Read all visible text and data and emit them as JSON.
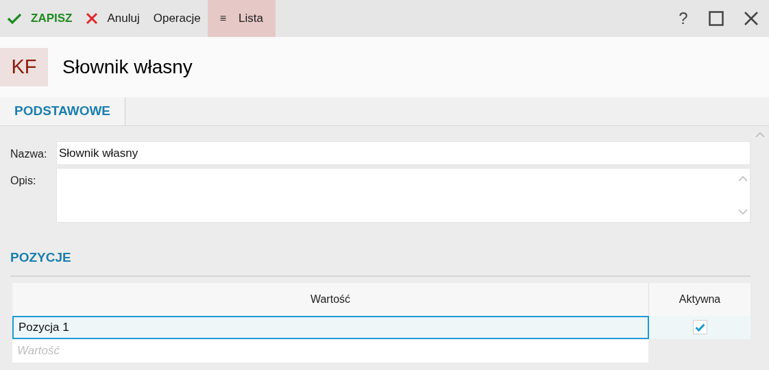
{
  "toolbar": {
    "items": [
      {
        "kind": "save",
        "label": "ZAPISZ",
        "selected": false
      },
      {
        "kind": "cancel",
        "label": "Anuluj",
        "selected": false
      },
      {
        "kind": "plain",
        "label": "Operacje",
        "selected": false
      },
      {
        "kind": "list",
        "icon": "≡",
        "label": "Lista",
        "selected": true
      }
    ],
    "help": "?"
  },
  "header": {
    "badge": "KF",
    "title": "Słownik własny"
  },
  "tabs": [
    {
      "label": "PODSTAWOWE",
      "selected": true
    }
  ],
  "form": {
    "fields": [
      {
        "label": "Nazwa:",
        "value": "Słownik własny",
        "kind": "line"
      },
      {
        "label": "Opis:",
        "kind": "area"
      }
    ]
  },
  "section": {
    "title": "POZYCJE"
  },
  "table": {
    "columns": [
      "Wartość",
      "Aktywna"
    ],
    "rows": [
      {
        "value": "Pozycja 1",
        "active": true,
        "selected": true
      }
    ],
    "new_row": {
      "placeholder": "Wartość"
    }
  }
}
